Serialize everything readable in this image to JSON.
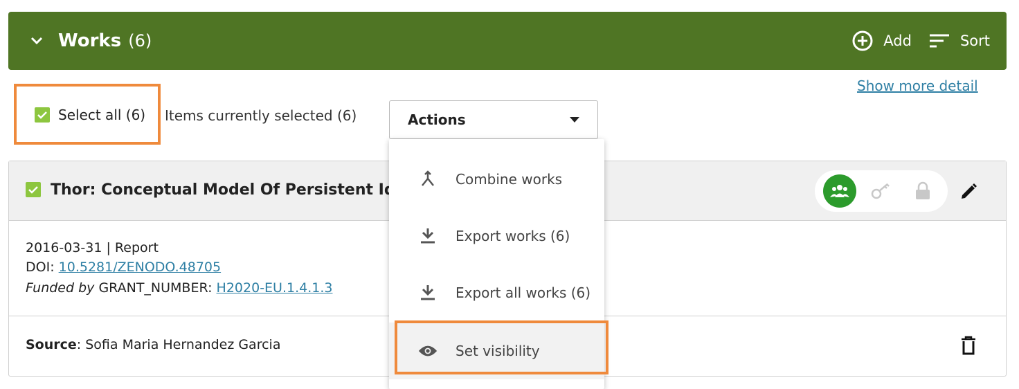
{
  "header": {
    "title": "Works",
    "count": "(6)",
    "add_label": "Add",
    "sort_label": "Sort"
  },
  "toolbar": {
    "select_all_label": "Select all (6)",
    "selected_text": "Items currently selected (6)",
    "actions_label": "Actions"
  },
  "menu": {
    "items": [
      {
        "label": "Combine works",
        "icon": "merge-icon"
      },
      {
        "label": "Export works (6)",
        "icon": "download-icon"
      },
      {
        "label": "Export all works (6)",
        "icon": "download-icon"
      },
      {
        "label": "Set visibility",
        "icon": "eye-icon"
      }
    ]
  },
  "work": {
    "title": "Thor: Conceptual Model Of Persistent Ide",
    "date": "2016-03-31",
    "type": "Report",
    "doi_label": "DOI:",
    "doi": "10.5281/ZENODO.48705",
    "funded_by": "Funded by",
    "grant_label": "GRANT_NUMBER:",
    "grant": "H2020-EU.1.4.1.3",
    "show_more": "Show more detail",
    "source_label": "Source",
    "source": "Sofia Maria Hernandez Garcia"
  },
  "colors": {
    "header_bg": "#4f7524",
    "highlight": "#ef8a3c",
    "checkbox": "#8dc63f",
    "visibility_active": "#2c9b2c",
    "link": "#2e7fa4"
  }
}
